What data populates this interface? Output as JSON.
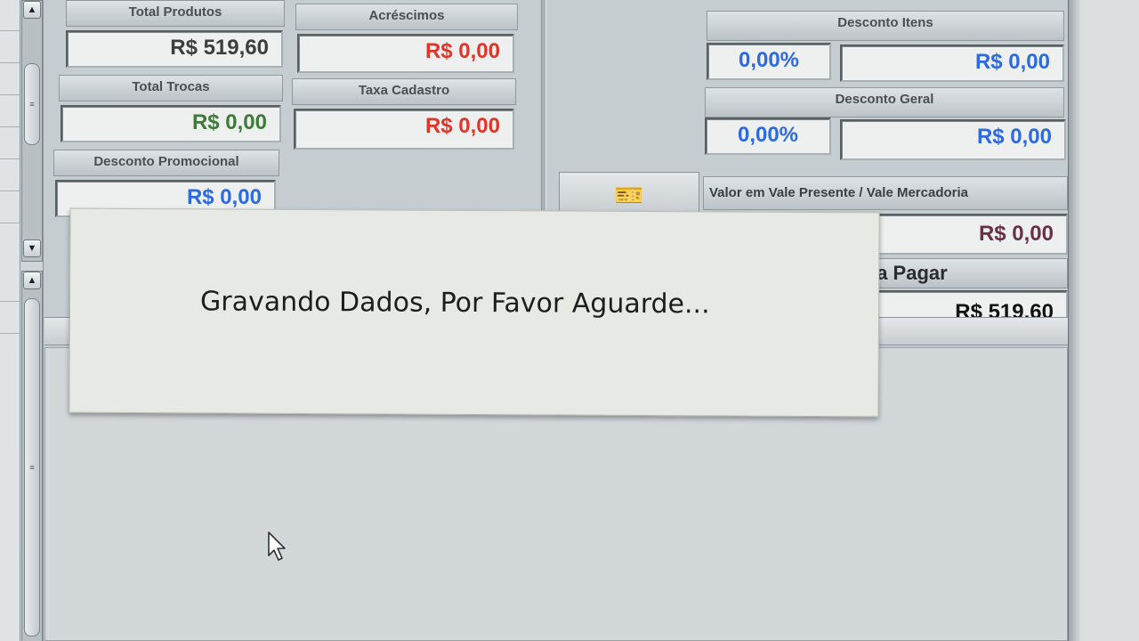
{
  "totals": {
    "total_produtos": {
      "label": "Total Produtos",
      "value": "R$ 519,60",
      "color": "#3d3d3d"
    },
    "acrescimos": {
      "label": "Acréscimos",
      "value": "R$ 0,00",
      "color": "#e0362a"
    },
    "total_trocas": {
      "label": "Total Trocas",
      "value": "R$ 0,00",
      "color": "#3f7a3a"
    },
    "taxa_cadastro": {
      "label": "Taxa Cadastro",
      "value": "R$ 0,00",
      "color": "#e0362a"
    },
    "desconto_promocional": {
      "label": "Desconto Promocional",
      "value": "R$ 0,00",
      "color": "#2d6ae0"
    }
  },
  "discounts": {
    "desconto_itens": {
      "label": "Desconto Itens",
      "percent": "0,00%",
      "value": "R$ 0,00"
    },
    "desconto_geral": {
      "label": "Desconto Geral",
      "percent": "0,00%",
      "value": "R$ 0,00"
    }
  },
  "vale": {
    "label": "Valor em Vale Presente / Vale Mercadoria",
    "value": "R$ 0,00",
    "color": "#6a3048",
    "icon": "gift-card-icon"
  },
  "valor_a_pagar": {
    "label": "Valor a Pagar",
    "value": "R$ 519,60"
  },
  "modal": {
    "message": "Gravando Dados, Por Favor Aguarde..."
  }
}
